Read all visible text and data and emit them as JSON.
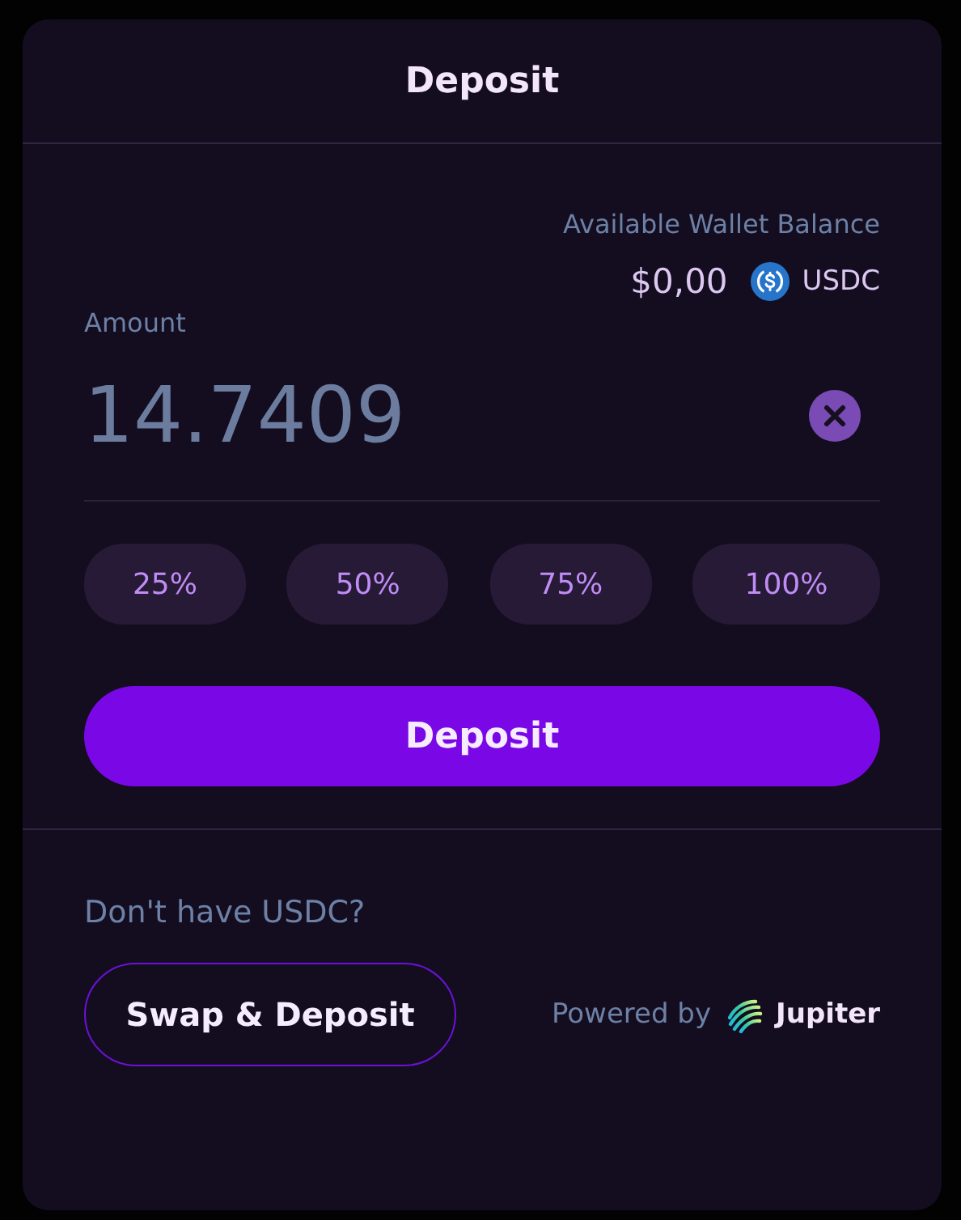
{
  "dialog": {
    "title": "Deposit"
  },
  "balance": {
    "label": "Available Wallet Balance",
    "value": "$0,00",
    "token": "USDC"
  },
  "amount": {
    "label": "Amount",
    "value": "14.7409"
  },
  "percent_buttons": [
    {
      "label": "25%",
      "selected": false
    },
    {
      "label": "50%",
      "selected": false
    },
    {
      "label": "75%",
      "selected": false
    },
    {
      "label": "100%",
      "selected": false
    }
  ],
  "submit": {
    "label": "Deposit"
  },
  "footer": {
    "prompt": "Don't have USDC?",
    "swap_button": "Swap & Deposit",
    "powered_by": "Powered by",
    "provider": "Jupiter"
  }
}
